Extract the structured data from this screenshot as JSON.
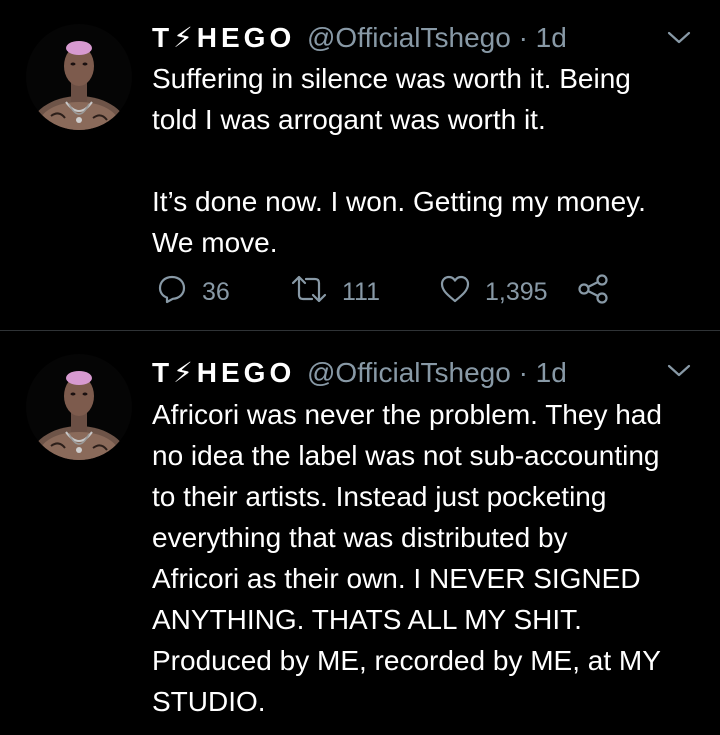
{
  "theme": {
    "background": "#000000",
    "text": "#ffffff",
    "muted": "#8899a6",
    "divider": "#2f3336"
  },
  "tweets": [
    {
      "name": "T⚡HEGO",
      "handle": "@OfficialTshego",
      "separator": "·",
      "time": "1d",
      "text": "Suffering in silence was worth it. Being\ntold I was arrogant was worth it.\n\nIt’s done now. I won. Getting my money.\nWe move.",
      "replies": "36",
      "retweets": "111",
      "likes": "1,395",
      "icons": [
        "reply-icon",
        "retweet-icon",
        "like-icon",
        "share-icon",
        "chevron-down-icon"
      ]
    },
    {
      "name": "T⚡HEGO",
      "handle": "@OfficialTshego",
      "separator": "·",
      "time": "1d",
      "text": "Africori was never the problem. They had\nno idea the label was not sub-accounting\nto their artists. Instead just pocketing\neverything that was distributed by\nAfricori as their own. I NEVER SIGNED\nANYTHING. THATS ALL MY SHIT.\nProduced by ME, recorded by ME, at MY\nSTUDIO.",
      "icons": [
        "chevron-down-icon"
      ]
    }
  ]
}
